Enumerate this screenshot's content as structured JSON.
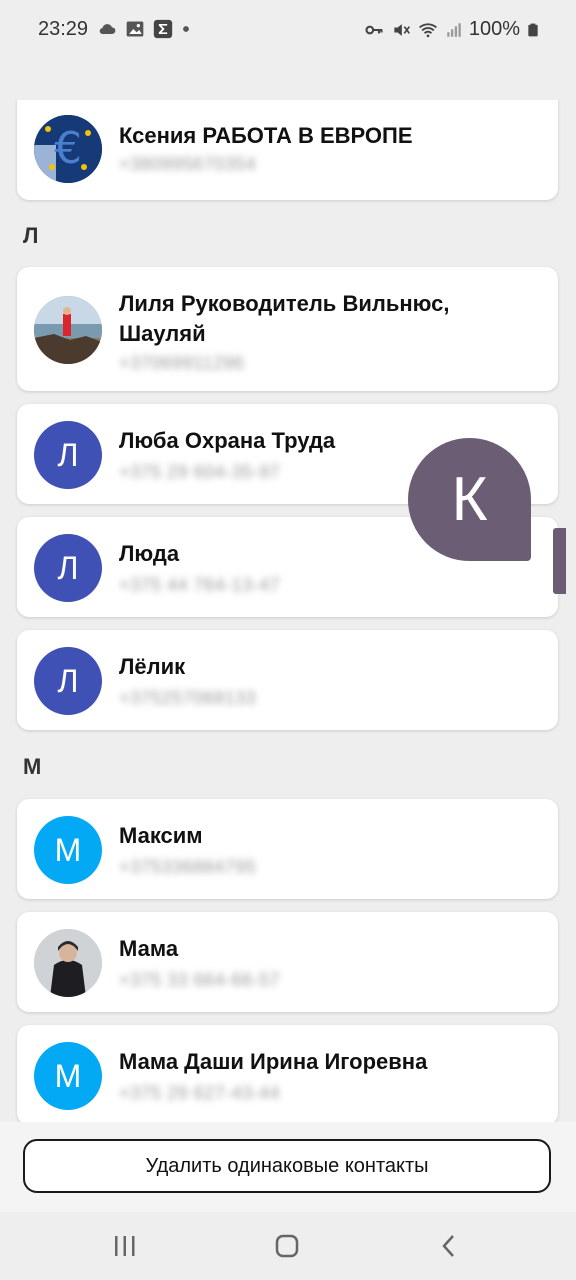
{
  "status_bar": {
    "time": "23:29",
    "battery": "100%",
    "left_icons": [
      "cloud-icon",
      "image-icon",
      "sigma-icon",
      "dot-icon"
    ],
    "right_icons": [
      "key-icon",
      "mute-vibrate-icon",
      "wifi-icon",
      "signal-icon",
      "battery-icon"
    ]
  },
  "sections": [
    {
      "letter": "",
      "contacts": [
        {
          "name": "Ксения РАБОТА В ЕВРОПЕ",
          "phone": "+380995670354",
          "avatar": "photo-euro"
        }
      ]
    },
    {
      "letter": "Л",
      "contacts": [
        {
          "name": "Лиля Руководитель Вильнюс, Шауляй",
          "phone": "+37069911296",
          "avatar": "photo-beach"
        },
        {
          "name": "Люба Охрана Труда",
          "phone": "+375 29 604-35-97",
          "avatar_letter": "Л",
          "avatar_color": "#3f51b5"
        },
        {
          "name": "Люда",
          "phone": "+375 44 764-13-47",
          "avatar_letter": "Л",
          "avatar_color": "#3f51b5"
        },
        {
          "name": "Лёлик",
          "phone": "+375257068133",
          "avatar_letter": "Л",
          "avatar_color": "#3f51b5"
        }
      ]
    },
    {
      "letter": "М",
      "contacts": [
        {
          "name": "Максим",
          "phone": "+375336884795",
          "avatar_letter": "М",
          "avatar_color": "#03a9f4"
        },
        {
          "name": "Мама",
          "phone": "+375 33 664-66-57",
          "avatar": "photo-winter"
        },
        {
          "name": "Мама Даши Ирина Игоревна",
          "phone": "+375 29 627-43-44",
          "avatar_letter": "М",
          "avatar_color": "#03a9f4"
        }
      ]
    }
  ],
  "index_bubble_letter": "К",
  "bottom_button_label": "Удалить одинаковые контакты",
  "colors": {
    "background": "#eeeeee",
    "card": "#ffffff",
    "avatar_l": "#3f51b5",
    "avatar_m": "#03a9f4",
    "index_bubble": "#6a5d74"
  },
  "nav_bar": [
    "recent-apps-icon",
    "home-icon",
    "back-icon"
  ]
}
